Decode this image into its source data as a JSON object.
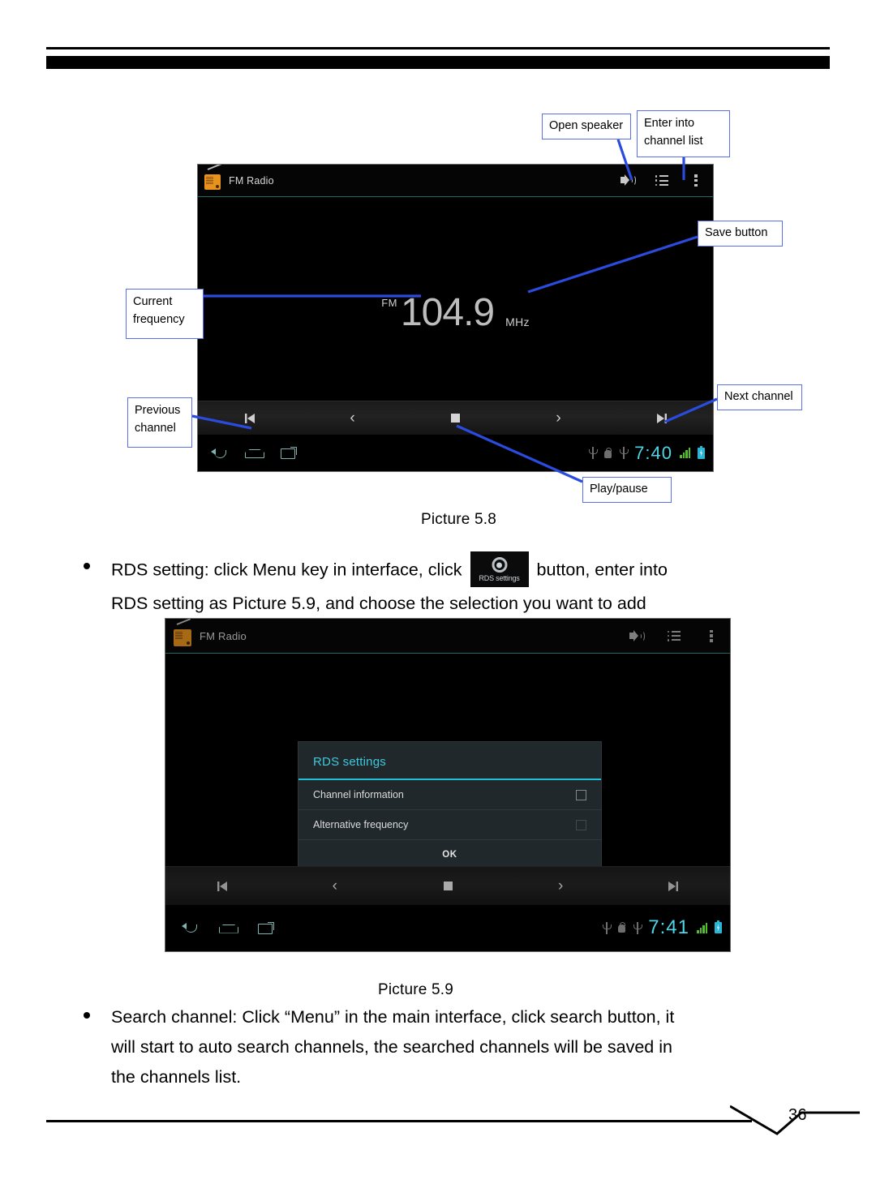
{
  "document": {
    "page_number": "36"
  },
  "figure_58": {
    "caption": "Picture 5.8",
    "app": {
      "title": "FM Radio",
      "icon": "radio-icon",
      "actions": [
        {
          "name": "speaker-icon",
          "label": "Open speaker"
        },
        {
          "name": "channel-list-icon",
          "label": "Enter into channel list"
        },
        {
          "name": "overflow-menu-icon",
          "label": "More options"
        }
      ],
      "frequency": {
        "band": "FM",
        "value": "104.9",
        "unit": "MHz",
        "star_icon": "★"
      },
      "controls": [
        {
          "name": "previous-channel-button",
          "glyph": "◄|"
        },
        {
          "name": "tune-down-button",
          "glyph": "‹"
        },
        {
          "name": "play-pause-button",
          "glyph": "■"
        },
        {
          "name": "tune-up-button",
          "glyph": "›"
        },
        {
          "name": "next-channel-button",
          "glyph": "|►"
        }
      ],
      "navbar": {
        "back": "back-icon",
        "home": "home-icon",
        "recents": "recents-icon",
        "time": "7:40",
        "status_icons": [
          "usb-icon",
          "android-debug-icon",
          "usb-icon",
          "signal-icon",
          "battery-charging-icon"
        ]
      }
    },
    "callouts": [
      {
        "id": "open-speaker",
        "text": "Open speaker"
      },
      {
        "id": "enter-channel-list",
        "text": "Enter into\nchannel list"
      },
      {
        "id": "save-button",
        "text": "Save  button"
      },
      {
        "id": "current-frequency",
        "text": "Current\nfrequency"
      },
      {
        "id": "previous-channel",
        "text": "Previous\nchannel"
      },
      {
        "id": "next-channel",
        "text": "Next channel"
      },
      {
        "id": "play-pause",
        "text": "Play/pause"
      }
    ]
  },
  "body": {
    "bullet_rds": {
      "part1": "RDS setting: click Menu key in interface, click",
      "icon_label": "RDS settings",
      "part2": "button, enter into",
      "line2": "RDS setting as Picture 5.9, and choose the selection you want to add"
    },
    "bullet_search": {
      "line1": "Search channel: Click “Menu” in the main interface, click search button, it",
      "line2": "will start to auto search channels, the searched channels will be saved in",
      "line3": "the channels list."
    }
  },
  "figure_59": {
    "caption": "Picture 5.9",
    "app": {
      "title": "FM Radio",
      "navbar": {
        "time": "7:41"
      }
    },
    "dialog": {
      "title": "RDS settings",
      "items": [
        {
          "label": "Channel information",
          "checked": false
        },
        {
          "label": "Alternative frequency",
          "checked": false
        }
      ],
      "ok_label": "OK"
    }
  }
}
